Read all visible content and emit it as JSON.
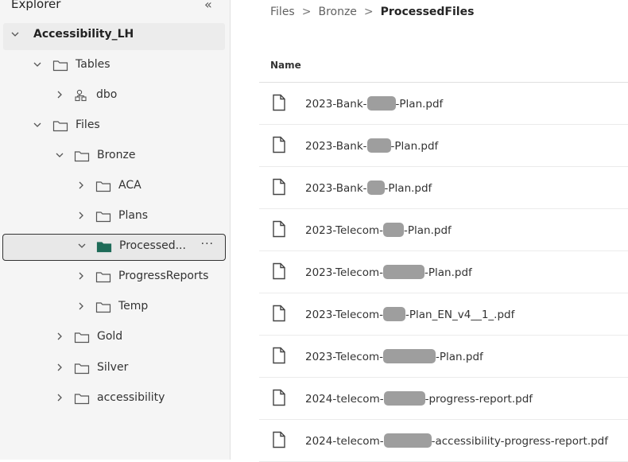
{
  "explorer": {
    "title": "Explorer",
    "tree": [
      {
        "label": "Accessibility_LH"
      },
      {
        "label": "Tables"
      },
      {
        "label": "dbo"
      },
      {
        "label": "Files"
      },
      {
        "label": "Bronze"
      },
      {
        "label": "ACA"
      },
      {
        "label": "Plans"
      },
      {
        "label": "Processed..."
      },
      {
        "label": "ProgressReports"
      },
      {
        "label": "Temp"
      },
      {
        "label": "Gold"
      },
      {
        "label": "Silver"
      },
      {
        "label": "accessibility"
      }
    ],
    "more_label": "···"
  },
  "breadcrumb": {
    "items": [
      "Files",
      "Bronze",
      "ProcessedFiles"
    ],
    "separator": ">"
  },
  "table": {
    "column_header": "Name",
    "files": [
      {
        "prefix": "2023-Bank-",
        "suffix": "-Plan.pdf"
      },
      {
        "prefix": "2023-Bank-",
        "suffix": "-Plan.pdf"
      },
      {
        "prefix": "2023-Bank-",
        "suffix": "-Plan.pdf"
      },
      {
        "prefix": "2023-Telecom-",
        "suffix": "-Plan.pdf"
      },
      {
        "prefix": "2023-Telecom-",
        "suffix": "-Plan.pdf"
      },
      {
        "prefix": "2023-Telecom-",
        "suffix": "-Plan_EN_v4__1_.pdf"
      },
      {
        "prefix": "2023-Telecom-",
        "suffix": "-Plan.pdf"
      },
      {
        "prefix": "2024-telecom-",
        "suffix": "-progress-report.pdf"
      },
      {
        "prefix": "2024-telecom-",
        "suffix": "-accessibility-progress-report.pdf"
      }
    ]
  },
  "colors": {
    "pane_bg": "#f5f5f5",
    "selected_folder": "#1e6b58",
    "redaction": "#9e9e9e"
  }
}
